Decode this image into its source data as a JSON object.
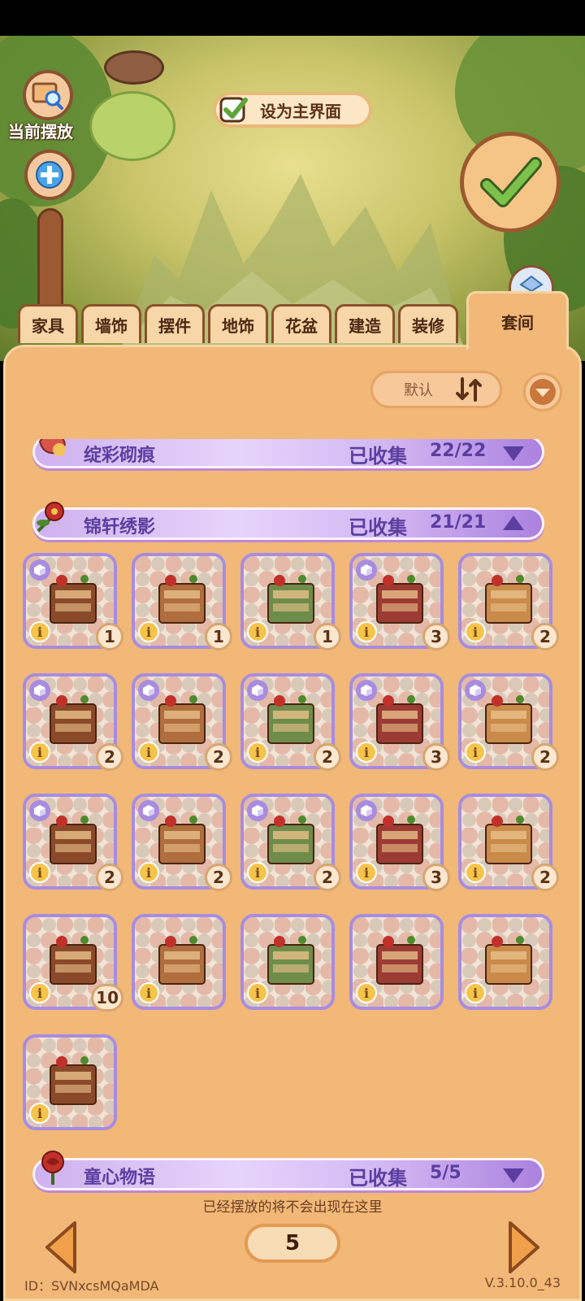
{
  "top": {
    "current_placement_label": "当前摆放",
    "set_main_label": "设为主界面"
  },
  "tabs": [
    {
      "label": "家具",
      "active": false
    },
    {
      "label": "墙饰",
      "active": false
    },
    {
      "label": "摆件",
      "active": false
    },
    {
      "label": "地饰",
      "active": false
    },
    {
      "label": "花盆",
      "active": false
    },
    {
      "label": "建造",
      "active": false
    },
    {
      "label": "装修",
      "active": false
    },
    {
      "label": "套间",
      "active": true
    }
  ],
  "sort": {
    "label": "默认"
  },
  "sets": [
    {
      "name": "绽彩砌痕",
      "collected_label": "已收集",
      "count": "22/22",
      "expanded": false
    },
    {
      "name": "锦轩绣影",
      "collected_label": "已收集",
      "count": "21/21",
      "expanded": true
    },
    {
      "name": "童心物语",
      "collected_label": "已收集",
      "count": "5/5",
      "expanded": false
    }
  ],
  "items": [
    {
      "icon": "desk-with-sewing-machine",
      "qty": "1",
      "has_cube": true
    },
    {
      "icon": "camellia-bonsai",
      "qty": "1",
      "has_cube": false
    },
    {
      "icon": "qipao-dress-form",
      "qty": "1",
      "has_cube": false
    },
    {
      "icon": "tall-drawer-cabinet",
      "qty": "3",
      "has_cube": true
    },
    {
      "icon": "carved-screen-arch",
      "qty": "2",
      "has_cube": false
    },
    {
      "icon": "sewing-workbench",
      "qty": "2",
      "has_cube": true
    },
    {
      "icon": "armchair-with-cushion",
      "qty": "2",
      "has_cube": true
    },
    {
      "icon": "rattan-armchair",
      "qty": "2",
      "has_cube": true
    },
    {
      "icon": "lattice-door",
      "qty": "3",
      "has_cube": true
    },
    {
      "icon": "lattice-window",
      "qty": "2",
      "has_cube": true
    },
    {
      "icon": "low-cabinet-with-cloth",
      "qty": "2",
      "has_cube": true
    },
    {
      "icon": "dresser-with-lace",
      "qty": "2",
      "has_cube": true
    },
    {
      "icon": "wall-fabric-display",
      "qty": "2",
      "has_cube": true
    },
    {
      "icon": "glass-display-counter",
      "qty": "3",
      "has_cube": true
    },
    {
      "icon": "oval-red-rug",
      "qty": "2",
      "has_cube": false
    },
    {
      "icon": "carved-wooden-panel",
      "qty": "10",
      "has_cube": false
    },
    {
      "icon": "wooden-wall-panel",
      "qty": "",
      "has_cube": false
    },
    {
      "icon": "patterned-floor-tile",
      "qty": "",
      "has_cube": false
    },
    {
      "icon": "open-wardrobe-with-flowers",
      "qty": "",
      "has_cube": false
    },
    {
      "icon": "flower-fence",
      "qty": "",
      "has_cube": false
    },
    {
      "icon": "ivy-stone-ruin",
      "qty": "",
      "has_cube": false
    }
  ],
  "footer": {
    "note": "已经摆放的将不会出现在这里",
    "page": "5",
    "id": "ID：SVNxcsMQaMDA",
    "version": "V.3.10.0_43"
  },
  "colors": {
    "panel": "#f1b878",
    "banner_text": "#5b3ea0",
    "card_border": "#a88ce0",
    "accent_green": "#5fa33a"
  }
}
